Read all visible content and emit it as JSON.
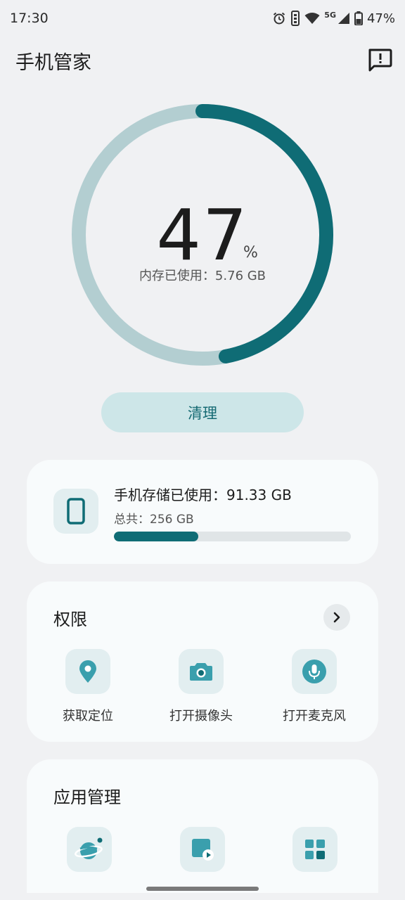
{
  "status_bar": {
    "time": "17:30",
    "network": "5G",
    "battery": "47%",
    "icons": [
      "alarm-icon",
      "vibrate-icon",
      "wifi-icon",
      "cellular-signal-icon",
      "battery-icon"
    ]
  },
  "header": {
    "title": "手机管家",
    "feedback_icon": "feedback-icon"
  },
  "memory": {
    "percent": 47,
    "percent_text": "47",
    "percent_sign": "%",
    "used_label": "内存已使用：5.76 GB"
  },
  "clean_button": {
    "label": "清理"
  },
  "storage": {
    "icon": "phone-icon",
    "used_label": "手机存储已使用：91.33 GB",
    "total_label": "总共：256 GB",
    "used_fraction": 0.357
  },
  "permissions": {
    "title": "权限",
    "arrow_icon": "chevron-right-icon",
    "items": [
      {
        "label": "获取定位",
        "icon": "location-icon"
      },
      {
        "label": "打开摄像头",
        "icon": "camera-icon"
      },
      {
        "label": "打开麦克风",
        "icon": "microphone-icon"
      }
    ]
  },
  "app_management": {
    "title": "应用管理",
    "items": [
      {
        "icon": "planet-icon"
      },
      {
        "icon": "media-icon"
      },
      {
        "icon": "apps-grid-icon"
      }
    ]
  },
  "colors": {
    "accent": "#0f6c75",
    "ring_track": "#b3ced1",
    "button_bg": "#cde6e8",
    "background": "#f0f1f3",
    "card_bg": "#f8fbfc"
  }
}
